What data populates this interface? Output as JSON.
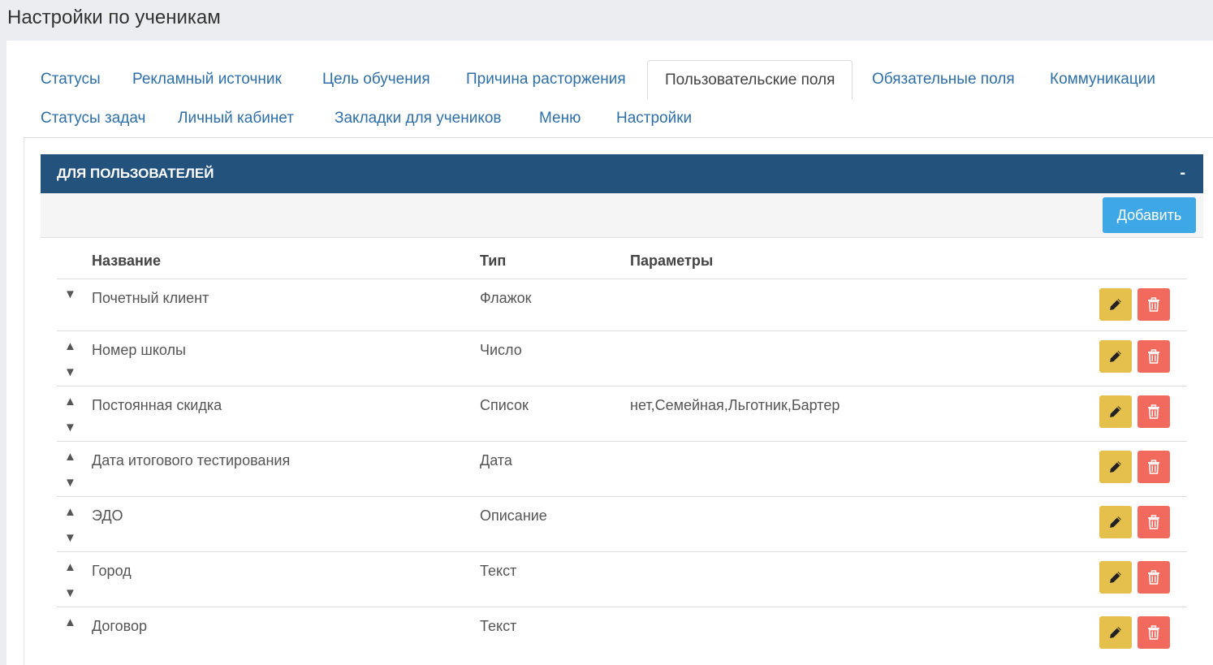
{
  "page": {
    "title": "Настройки по ученикам"
  },
  "tabs": [
    {
      "label": "Статусы"
    },
    {
      "label": "Рекламный источник"
    },
    {
      "label": "Цель обучения"
    },
    {
      "label": "Причина расторжения"
    },
    {
      "label": "Пользовательские поля",
      "active": true
    },
    {
      "label": "Обязательные поля"
    },
    {
      "label": "Коммуникации"
    },
    {
      "label": "Статусы задач"
    },
    {
      "label": "Личный кабинет"
    },
    {
      "label": "Закладки для учеников"
    },
    {
      "label": "Меню"
    },
    {
      "label": "Настройки"
    }
  ],
  "panel": {
    "title": "ДЛЯ ПОЛЬЗОВАТЕЛЕЙ",
    "collapse": "-",
    "add_label": "Добавить"
  },
  "table": {
    "headers": {
      "name": "Название",
      "type": "Тип",
      "params": "Параметры"
    },
    "up_glyph": "▲",
    "down_glyph": "▼",
    "rows": [
      {
        "name": "Почетный клиент",
        "type": "Флажок",
        "params": ""
      },
      {
        "name": "Номер школы",
        "type": "Число",
        "params": ""
      },
      {
        "name": "Постоянная скидка",
        "type": "Список",
        "params": "нет,Семейная,Льготник,Бартер"
      },
      {
        "name": "Дата итогового тестирования",
        "type": "Дата",
        "params": ""
      },
      {
        "name": "ЭДО",
        "type": "Описание",
        "params": ""
      },
      {
        "name": "Город",
        "type": "Текст",
        "params": ""
      },
      {
        "name": "Договор",
        "type": "Текст",
        "params": ""
      }
    ]
  },
  "icons": {
    "edit": "pencil-icon",
    "delete": "trash-icon"
  },
  "colors": {
    "header": "#23527c",
    "add": "#3ea8e6",
    "edit": "#e6c04d",
    "delete": "#f26a5e",
    "link": "#2f6fa7"
  }
}
